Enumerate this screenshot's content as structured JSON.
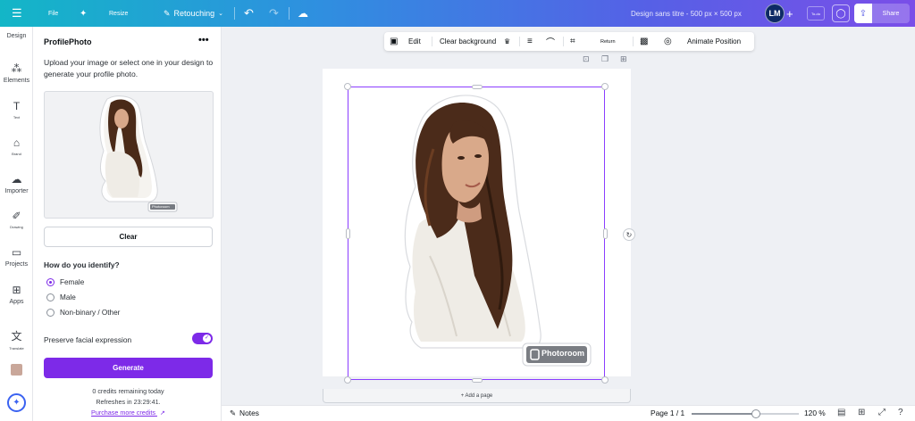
{
  "topbar": {
    "menu_icon": "menu-icon",
    "file": "File",
    "resize": "Resize",
    "retouching": "Retouching",
    "doc_title": "Design sans titre - 500 px × 500 px",
    "avatar_initials": "LM",
    "todo": "To-do",
    "share": "Share"
  },
  "rail": {
    "items": [
      {
        "label": "Design",
        "icon": "design-icon"
      },
      {
        "label": "Elements",
        "icon": "elements-icon"
      },
      {
        "label": "Text",
        "icon": "text-icon"
      },
      {
        "label": "Brand",
        "icon": "brand-icon"
      },
      {
        "label": "Importer",
        "icon": "upload-icon"
      },
      {
        "label": "Drawing",
        "icon": "drawing-icon"
      },
      {
        "label": "Projects",
        "icon": "folder-icon"
      },
      {
        "label": "Apps",
        "icon": "apps-icon"
      },
      {
        "label": "Translate",
        "icon": "translate-icon"
      }
    ]
  },
  "panel": {
    "title": "ProfilePhoto",
    "description": "Upload your image or select one in your design to generate your profile photo.",
    "clear": "Clear",
    "question": "How do you identify?",
    "options": [
      "Female",
      "Male",
      "Non-binary / Other"
    ],
    "selected_option": "Female",
    "preserve_label": "Preserve facial expression",
    "preserve_on": true,
    "generate": "Generate",
    "credits_line": "0 credits remaining today",
    "refresh_line": "Refreshes in  23:29:41.",
    "purchase_link": "Purchase more credits"
  },
  "context_toolbar": {
    "edit": "Edit",
    "clear_background": "Clear background",
    "return": "Return",
    "animate": "Animate Position"
  },
  "canvas": {
    "watermark": "Photoroom",
    "add_page": "+ Add a page"
  },
  "bottombar": {
    "notes": "Notes",
    "page": "Page 1 / 1",
    "zoom": "120 %",
    "zoom_level": 0.6
  },
  "colors": {
    "accent": "#7d2ae8",
    "selection": "#8b3dff"
  }
}
